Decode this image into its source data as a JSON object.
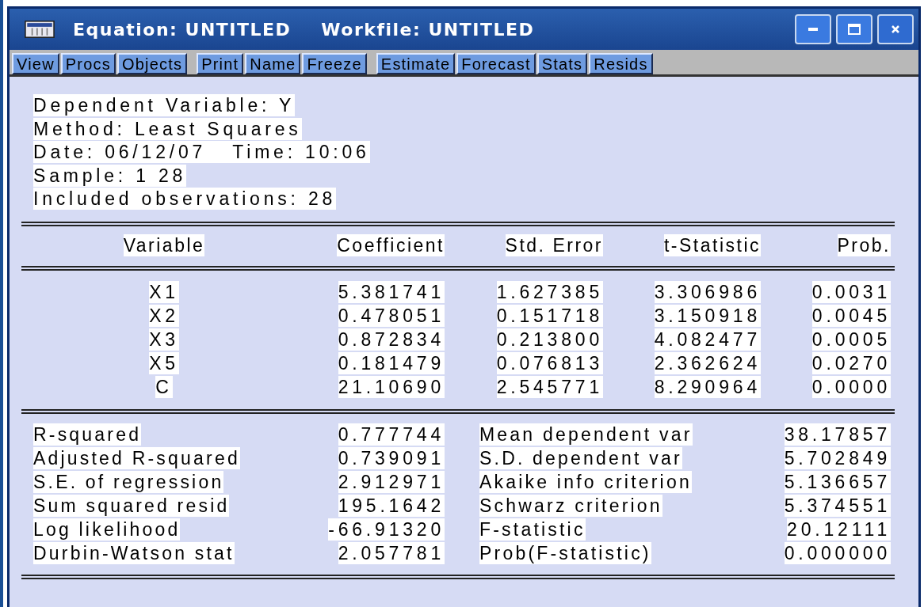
{
  "window": {
    "title": "Equation: UNTITLED",
    "workfile": "Workfile: UNTITLED"
  },
  "toolbar": [
    [
      "View",
      "Procs",
      "Objects"
    ],
    [
      "Print",
      "Name",
      "Freeze"
    ],
    [
      "Estimate",
      "Forecast",
      "Stats",
      "Resids"
    ]
  ],
  "header": [
    "Dependent Variable: Y",
    "Method: Least Squares",
    "Date: 06/12/07   Time: 10:06",
    "Sample: 1 28",
    "Included observations: 28"
  ],
  "table": {
    "columns": [
      "Variable",
      "Coefficient",
      "Std. Error",
      "t-Statistic",
      "Prob."
    ],
    "rows": [
      [
        "X1",
        "5.381741",
        "1.627385",
        "3.306986",
        "0.0031"
      ],
      [
        "X2",
        "0.478051",
        "0.151718",
        "3.150918",
        "0.0045"
      ],
      [
        "X3",
        "0.872834",
        "0.213800",
        "4.082477",
        "0.0005"
      ],
      [
        "X5",
        "0.181479",
        "0.076813",
        "2.362624",
        "0.0270"
      ],
      [
        "C",
        "21.10690",
        "2.545771",
        "8.290964",
        "0.0000"
      ]
    ]
  },
  "statistics": [
    [
      "R-squared",
      "0.777744",
      "Mean dependent var",
      "38.17857"
    ],
    [
      "Adjusted R-squared",
      "0.739091",
      "S.D. dependent var",
      "5.702849"
    ],
    [
      "S.E. of regression",
      "2.912971",
      "Akaike info criterion",
      "5.136657"
    ],
    [
      "Sum squared resid",
      "195.1642",
      "Schwarz criterion",
      "5.374551"
    ],
    [
      "Log likelihood",
      "-66.91320",
      "F-statistic",
      "20.12111"
    ],
    [
      "Durbin-Watson stat",
      "2.057781",
      "Prob(F-statistic)",
      "0.000000"
    ]
  ]
}
